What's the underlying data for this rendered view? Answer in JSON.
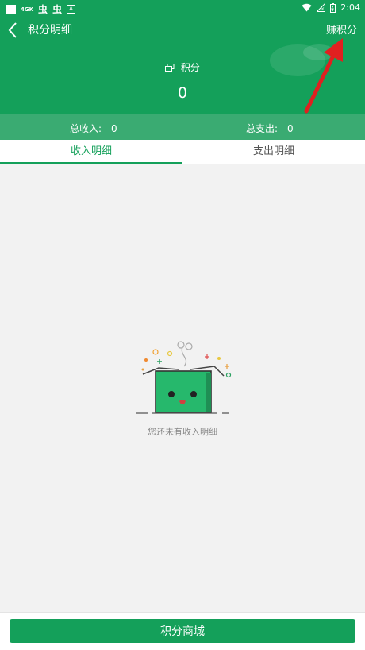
{
  "status_bar": {
    "net_label": "4GK",
    "app_glyph_1": "虫",
    "app_glyph_2": "虫",
    "badge": "A",
    "time": "2:04"
  },
  "header": {
    "title": "积分明细",
    "earn_label": "赚积分",
    "points_label": "积分",
    "points_value": "0"
  },
  "summary": {
    "income_label": "总收入:",
    "income_value": "0",
    "expense_label": "总支出:",
    "expense_value": "0"
  },
  "tabs": [
    {
      "label": "收入明细",
      "active": true
    },
    {
      "label": "支出明细",
      "active": false
    }
  ],
  "empty_state": {
    "message": "您还未有收入明细"
  },
  "bottom": {
    "mall_button": "积分商城"
  },
  "colors": {
    "primary": "#14a05a",
    "summary_bg": "#3aab72",
    "annotation_arrow": "#e02020"
  }
}
